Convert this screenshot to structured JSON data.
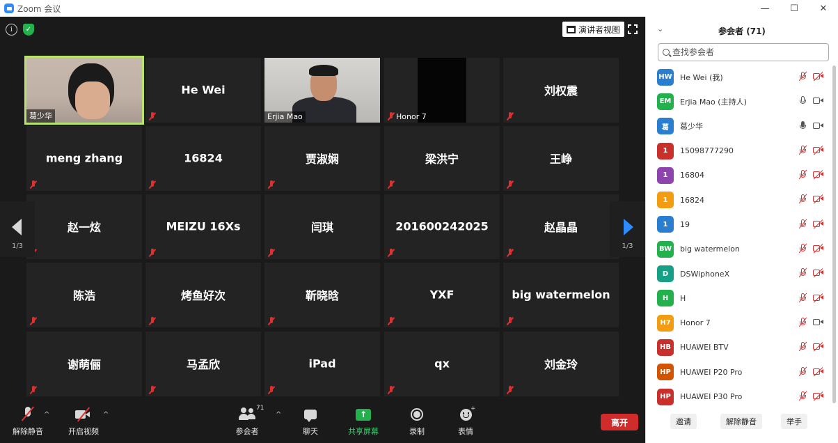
{
  "window": {
    "title": "Zoom 会议",
    "minimize": "—",
    "maximize": "☐",
    "close": "✕"
  },
  "video": {
    "speaker_view_label": "演讲者视图",
    "page_indicator": "1/3",
    "tiles": [
      {
        "name": "葛少华",
        "kind": "video"
      },
      {
        "name": "He Wei",
        "kind": "name"
      },
      {
        "name": "Erjia Mao",
        "kind": "video"
      },
      {
        "name": "Honor 7",
        "kind": "video"
      },
      {
        "name": "刘权震",
        "kind": "name"
      },
      {
        "name": "meng zhang",
        "kind": "name"
      },
      {
        "name": "16824",
        "kind": "name"
      },
      {
        "name": "贾淑娴",
        "kind": "name"
      },
      {
        "name": "梁洪宁",
        "kind": "name"
      },
      {
        "name": "王峥",
        "kind": "name"
      },
      {
        "name": "赵一炫",
        "kind": "name"
      },
      {
        "name": "MEIZU 16Xs",
        "kind": "name"
      },
      {
        "name": "闫琪",
        "kind": "name"
      },
      {
        "name": "201600242025",
        "kind": "name"
      },
      {
        "name": "赵晶晶",
        "kind": "name"
      },
      {
        "name": "陈浩",
        "kind": "name"
      },
      {
        "name": "烤鱼好次",
        "kind": "name"
      },
      {
        "name": "靳晓晗",
        "kind": "name"
      },
      {
        "name": "YXF",
        "kind": "name"
      },
      {
        "name": "big watermelon",
        "kind": "name"
      },
      {
        "name": "谢萌俪",
        "kind": "name"
      },
      {
        "name": "马孟欣",
        "kind": "name"
      },
      {
        "name": "iPad",
        "kind": "name"
      },
      {
        "name": "qx",
        "kind": "name"
      },
      {
        "name": "刘金玲",
        "kind": "name"
      }
    ]
  },
  "toolbar": {
    "unmute_label": "解除静音",
    "start_video_label": "开启视频",
    "participants_label": "参会者",
    "participants_count": "71",
    "chat_label": "聊天",
    "share_label": "共享屏幕",
    "record_label": "录制",
    "reactions_label": "表情",
    "leave_label": "离开",
    "caret": "^"
  },
  "panel": {
    "title": "参会者 (71)",
    "collapse": "⌄",
    "search_placeholder": "查找参会者",
    "participants": [
      {
        "initials": "HW",
        "name": "He Wei (我)",
        "color": "#2a7ed0",
        "mic": "muted",
        "cam": "off"
      },
      {
        "initials": "EM",
        "name": "Erjia Mao (主持人)",
        "color": "#23b14d",
        "mic": "on",
        "cam": "on"
      },
      {
        "initials": "葛",
        "name": "葛少华",
        "color": "#2a7ed0",
        "mic": "live",
        "cam": "on"
      },
      {
        "initials": "1",
        "name": "15098777290",
        "color": "#c9302c",
        "mic": "muted",
        "cam": "off"
      },
      {
        "initials": "1",
        "name": "16804",
        "color": "#8e44ad",
        "mic": "muted",
        "cam": "off"
      },
      {
        "initials": "1",
        "name": "16824",
        "color": "#f39c12",
        "mic": "muted",
        "cam": "off"
      },
      {
        "initials": "1",
        "name": "19",
        "color": "#2a7ed0",
        "mic": "muted",
        "cam": "off"
      },
      {
        "initials": "BW",
        "name": "big watermelon",
        "color": "#23b14d",
        "mic": "muted",
        "cam": "off"
      },
      {
        "initials": "D",
        "name": "DSWiphoneX",
        "color": "#16a085",
        "mic": "muted",
        "cam": "off"
      },
      {
        "initials": "H",
        "name": "H",
        "color": "#23b14d",
        "mic": "muted",
        "cam": "off"
      },
      {
        "initials": "H7",
        "name": "Honor 7",
        "color": "#f39c12",
        "mic": "muted",
        "cam": "on"
      },
      {
        "initials": "HB",
        "name": "HUAWEI BTV",
        "color": "#c9302c",
        "mic": "muted",
        "cam": "off"
      },
      {
        "initials": "HP",
        "name": "HUAWEI P20 Pro",
        "color": "#d35400",
        "mic": "muted",
        "cam": "off"
      },
      {
        "initials": "HP",
        "name": "HUAWEI P30 Pro",
        "color": "#c9302c",
        "mic": "muted",
        "cam": "off"
      }
    ],
    "footer": {
      "invite": "邀请",
      "unmute_all": "解除静音",
      "raise_hand": "举手"
    }
  }
}
